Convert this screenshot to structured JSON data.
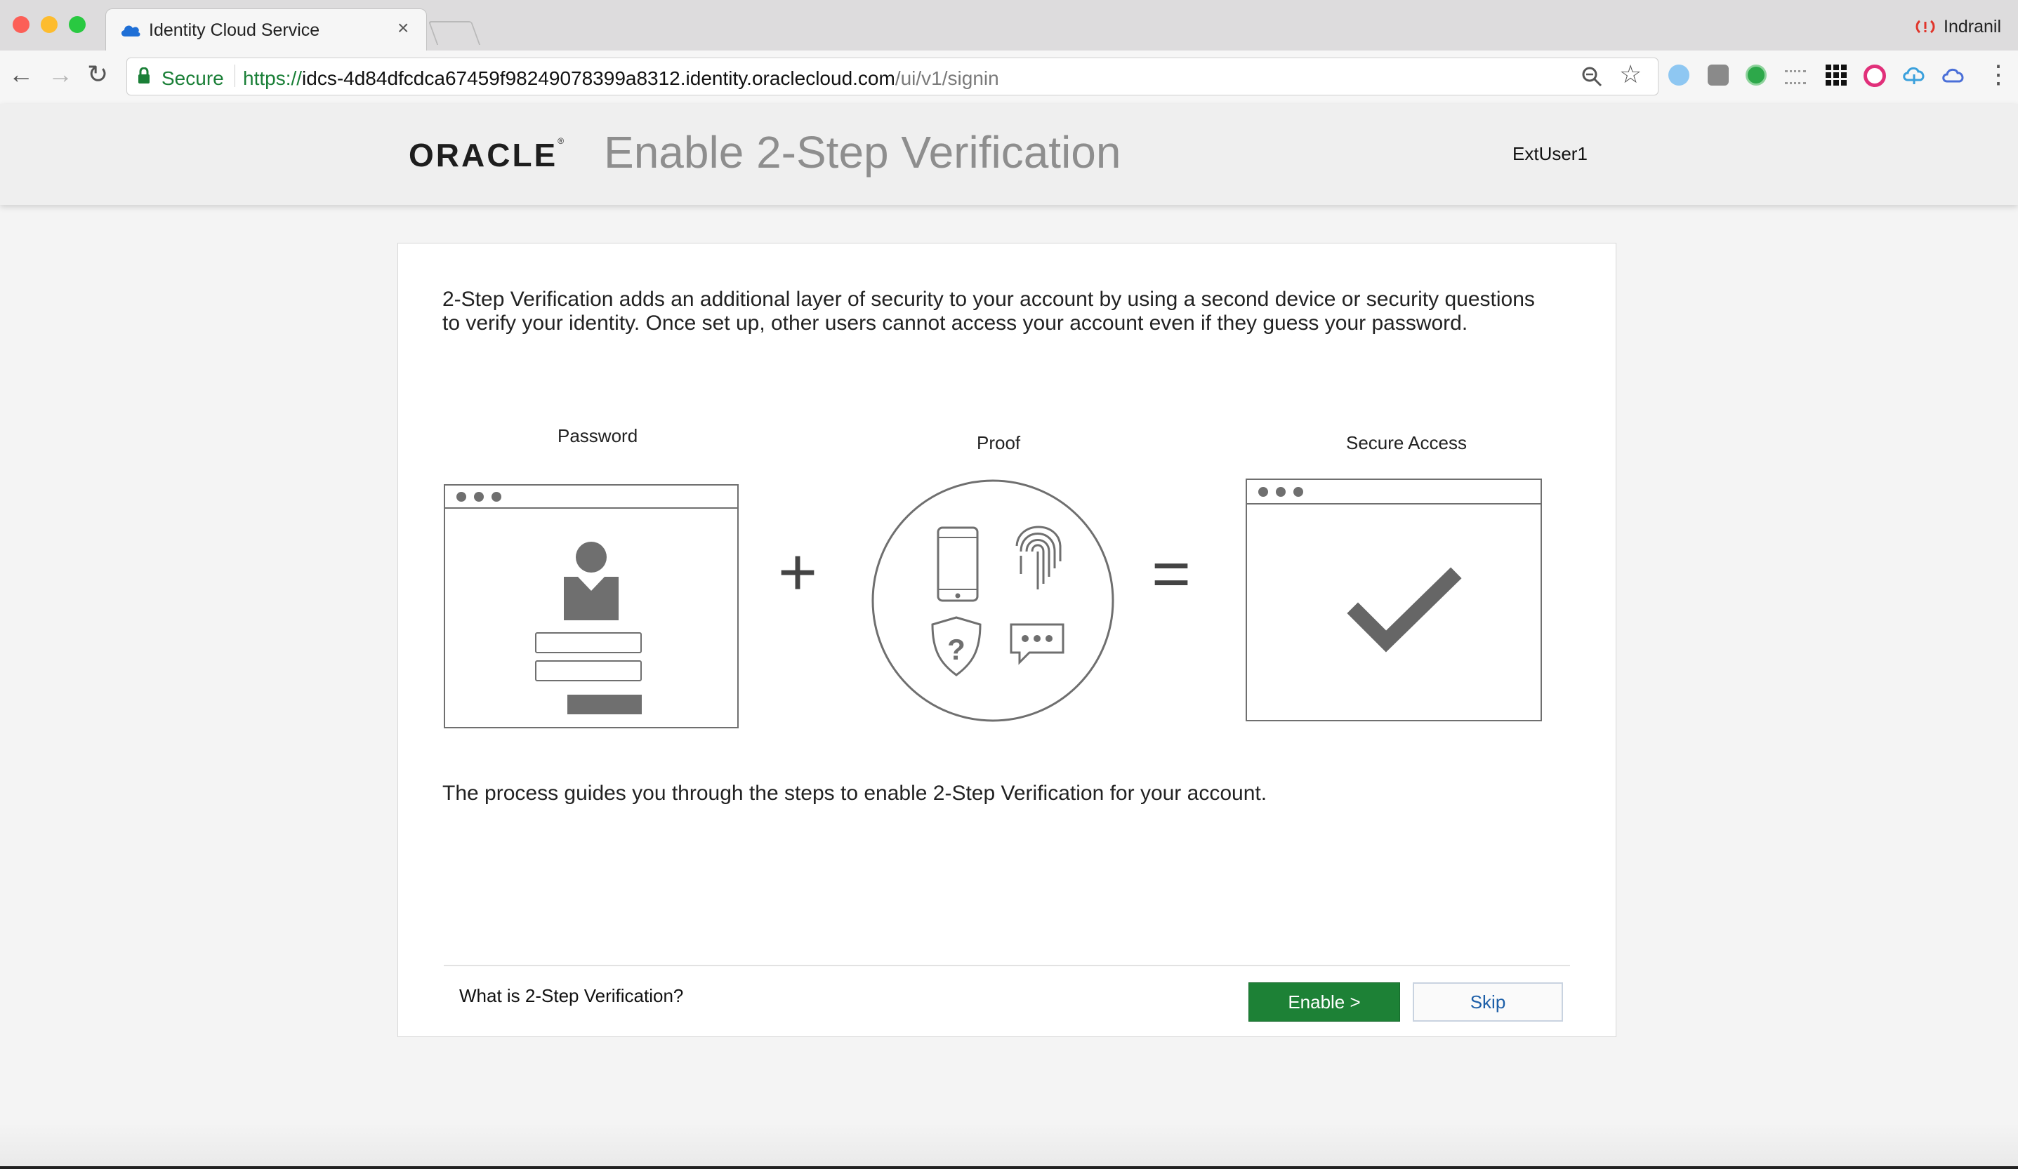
{
  "browser": {
    "tab": {
      "title": "Identity Cloud Service",
      "close": "×"
    },
    "profile": "Indranil",
    "address": {
      "secure_label": "Secure",
      "scheme": "https://",
      "host": "idcs-4d84dfcdca67459f98249078399a8312.identity.oraclecloud.com",
      "path": "/ui/v1/signin"
    },
    "nav": {
      "back": "←",
      "forward": "→",
      "reload": "↻"
    },
    "actions": {
      "zoom": "⚲",
      "bookmark": "☆",
      "menu": "⋮"
    },
    "extension_icons": [
      "snowflake-icon",
      "square-icon",
      "green-dot-icon",
      "sliders-icon",
      "grid-icon",
      "pink-circle-icon",
      "cloud-sync-icon",
      "cloud-icon"
    ]
  },
  "header": {
    "logo": "ORACLE",
    "logo_mark": "®",
    "title": "Enable 2-Step Verification",
    "user": "ExtUser1"
  },
  "content": {
    "intro": "2-Step Verification adds an additional layer of security to your account by using a second device or security questions to verify your identity. Once set up, other users cannot access your account even if they guess your password.",
    "steps": {
      "password": "Password",
      "proof": "Proof",
      "secure_access": "Secure Access"
    },
    "operators": {
      "plus": "+",
      "equals": "="
    },
    "guide": "The process guides you through the steps to enable 2-Step Verification for your account."
  },
  "footer": {
    "what_is": "What is 2-Step Verification?",
    "enable": "Enable >",
    "skip": "Skip"
  },
  "colors": {
    "accent_green": "#1d8136",
    "link_blue": "#1d5fa8",
    "illustration_gray": "#6f6f6f"
  }
}
